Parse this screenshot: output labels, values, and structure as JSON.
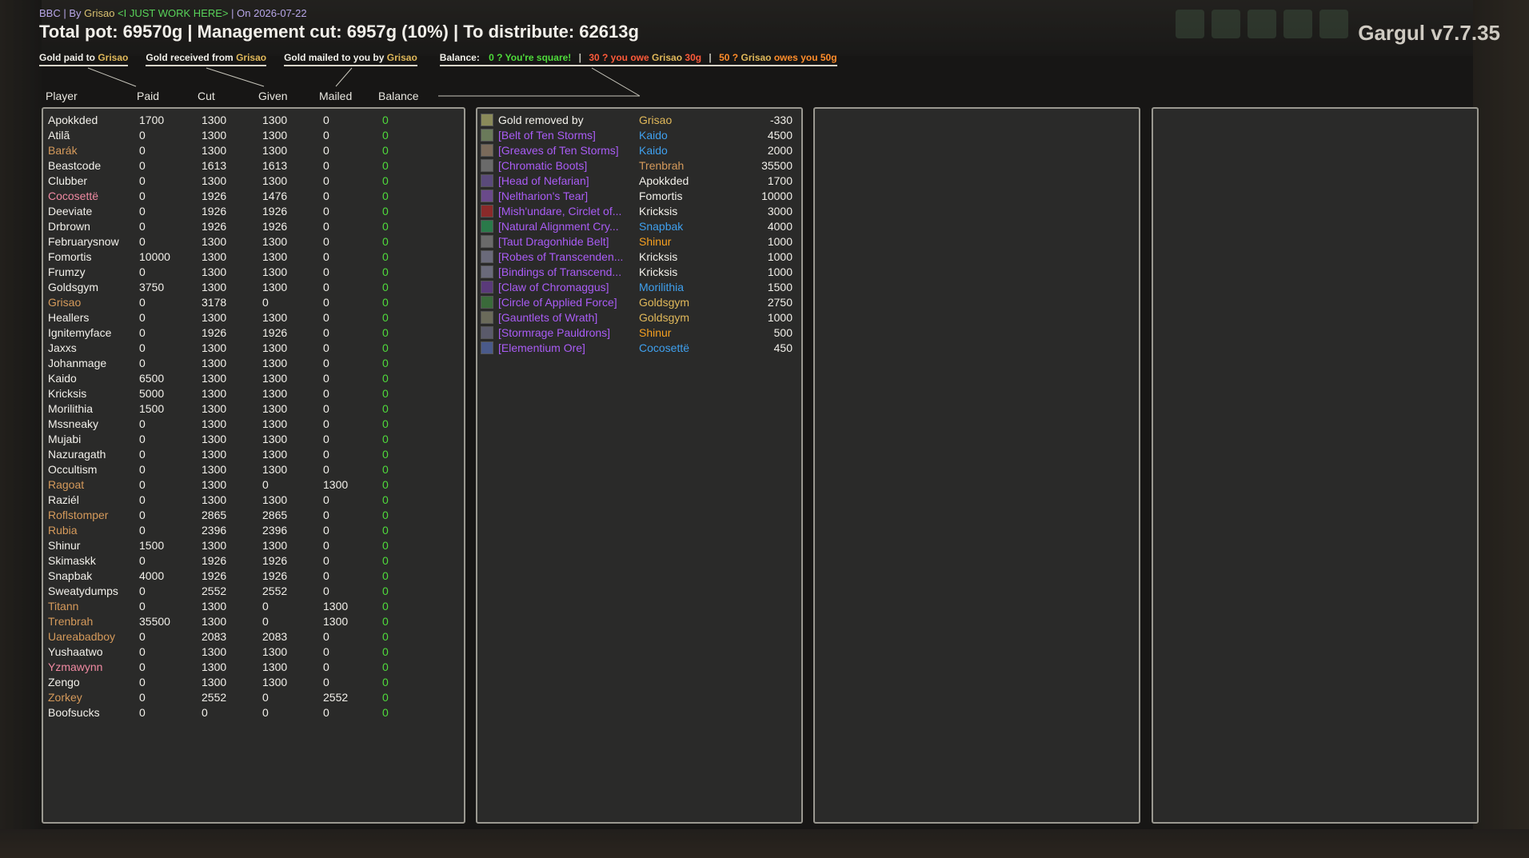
{
  "header": {
    "meta_prefix": "BBC | By",
    "meta_author": "Grisao",
    "meta_guild": "<I JUST WORK HERE>",
    "meta_date": "| On 2026-07-22",
    "title": "Total pot: 69570g | Management cut: 6957g (10%) | To distribute: 62613g",
    "brand": "Gargul v7.7.35"
  },
  "tabs": {
    "paid_label": "Gold paid to",
    "paid_name": "Grisao",
    "received_label": "Gold received from",
    "received_name": "Grisao",
    "mailed_label": "Gold mailed to you by",
    "mailed_name": "Grisao"
  },
  "balance": {
    "label": "Balance:",
    "square": "0 ? You're square!",
    "owe_prefix": "30 ? you owe",
    "owe_name": "Grisao",
    "owe_amount": "30g",
    "owed_prefix": "50 ?",
    "owed_name": "Grisao",
    "owed_suffix": "owes you 50g",
    "pipe": "|"
  },
  "columns": {
    "player": "Player",
    "paid": "Paid",
    "cut": "Cut",
    "given": "Given",
    "mailed": "Mailed",
    "balance": "Balance"
  },
  "players": [
    {
      "name": "Apokkded",
      "paid": "1700",
      "cut": "1300",
      "given": "1300",
      "mailed": "0",
      "balance": "0",
      "color": "white"
    },
    {
      "name": "Atilã",
      "paid": "0",
      "cut": "1300",
      "given": "1300",
      "mailed": "0",
      "balance": "0",
      "color": "white"
    },
    {
      "name": "Barák",
      "paid": "0",
      "cut": "1300",
      "given": "1300",
      "mailed": "0",
      "balance": "0",
      "color": "orange"
    },
    {
      "name": "Beastcode",
      "paid": "0",
      "cut": "1613",
      "given": "1613",
      "mailed": "0",
      "balance": "0",
      "color": "white"
    },
    {
      "name": "Clubber",
      "paid": "0",
      "cut": "1300",
      "given": "1300",
      "mailed": "0",
      "balance": "0",
      "color": "white"
    },
    {
      "name": "Cocosettë",
      "paid": "0",
      "cut": "1926",
      "given": "1476",
      "mailed": "0",
      "balance": "0",
      "color": "pink"
    },
    {
      "name": "Deeviate",
      "paid": "0",
      "cut": "1926",
      "given": "1926",
      "mailed": "0",
      "balance": "0",
      "color": "white"
    },
    {
      "name": "Drbrown",
      "paid": "0",
      "cut": "1926",
      "given": "1926",
      "mailed": "0",
      "balance": "0",
      "color": "white"
    },
    {
      "name": "Februarysnow",
      "paid": "0",
      "cut": "1300",
      "given": "1300",
      "mailed": "0",
      "balance": "0",
      "color": "white"
    },
    {
      "name": "Fomortis",
      "paid": "10000",
      "cut": "1300",
      "given": "1300",
      "mailed": "0",
      "balance": "0",
      "color": "white"
    },
    {
      "name": "Frumzy",
      "paid": "0",
      "cut": "1300",
      "given": "1300",
      "mailed": "0",
      "balance": "0",
      "color": "white"
    },
    {
      "name": "Goldsgym",
      "paid": "3750",
      "cut": "1300",
      "given": "1300",
      "mailed": "0",
      "balance": "0",
      "color": "white"
    },
    {
      "name": "Grisao",
      "paid": "0",
      "cut": "3178",
      "given": "0",
      "mailed": "0",
      "balance": "0",
      "color": "orange"
    },
    {
      "name": "Heallers",
      "paid": "0",
      "cut": "1300",
      "given": "1300",
      "mailed": "0",
      "balance": "0",
      "color": "white"
    },
    {
      "name": "Ignitemyface",
      "paid": "0",
      "cut": "1926",
      "given": "1926",
      "mailed": "0",
      "balance": "0",
      "color": "white"
    },
    {
      "name": "Jaxxs",
      "paid": "0",
      "cut": "1300",
      "given": "1300",
      "mailed": "0",
      "balance": "0",
      "color": "white"
    },
    {
      "name": "Johanmage",
      "paid": "0",
      "cut": "1300",
      "given": "1300",
      "mailed": "0",
      "balance": "0",
      "color": "white"
    },
    {
      "name": "Kaido",
      "paid": "6500",
      "cut": "1300",
      "given": "1300",
      "mailed": "0",
      "balance": "0",
      "color": "white"
    },
    {
      "name": "Kricksis",
      "paid": "5000",
      "cut": "1300",
      "given": "1300",
      "mailed": "0",
      "balance": "0",
      "color": "white"
    },
    {
      "name": "Morilithia",
      "paid": "1500",
      "cut": "1300",
      "given": "1300",
      "mailed": "0",
      "balance": "0",
      "color": "white"
    },
    {
      "name": "Mssneaky",
      "paid": "0",
      "cut": "1300",
      "given": "1300",
      "mailed": "0",
      "balance": "0",
      "color": "white"
    },
    {
      "name": "Mujabi",
      "paid": "0",
      "cut": "1300",
      "given": "1300",
      "mailed": "0",
      "balance": "0",
      "color": "white"
    },
    {
      "name": "Nazuragath",
      "paid": "0",
      "cut": "1300",
      "given": "1300",
      "mailed": "0",
      "balance": "0",
      "color": "white"
    },
    {
      "name": "Occultism",
      "paid": "0",
      "cut": "1300",
      "given": "1300",
      "mailed": "0",
      "balance": "0",
      "color": "white"
    },
    {
      "name": "Ragoat",
      "paid": "0",
      "cut": "1300",
      "given": "0",
      "mailed": "1300",
      "balance": "0",
      "color": "orange"
    },
    {
      "name": "Raziél",
      "paid": "0",
      "cut": "1300",
      "given": "1300",
      "mailed": "0",
      "balance": "0",
      "color": "white"
    },
    {
      "name": "Roflstomper",
      "paid": "0",
      "cut": "2865",
      "given": "2865",
      "mailed": "0",
      "balance": "0",
      "color": "orange"
    },
    {
      "name": "Rubia",
      "paid": "0",
      "cut": "2396",
      "given": "2396",
      "mailed": "0",
      "balance": "0",
      "color": "orange"
    },
    {
      "name": "Shinur",
      "paid": "1500",
      "cut": "1300",
      "given": "1300",
      "mailed": "0",
      "balance": "0",
      "color": "white"
    },
    {
      "name": "Skimaskk",
      "paid": "0",
      "cut": "1926",
      "given": "1926",
      "mailed": "0",
      "balance": "0",
      "color": "white"
    },
    {
      "name": "Snapbak",
      "paid": "4000",
      "cut": "1926",
      "given": "1926",
      "mailed": "0",
      "balance": "0",
      "color": "white"
    },
    {
      "name": "Sweatydumps",
      "paid": "0",
      "cut": "2552",
      "given": "2552",
      "mailed": "0",
      "balance": "0",
      "color": "white"
    },
    {
      "name": "Titann",
      "paid": "0",
      "cut": "1300",
      "given": "0",
      "mailed": "1300",
      "balance": "0",
      "color": "orange"
    },
    {
      "name": "Trenbrah",
      "paid": "35500",
      "cut": "1300",
      "given": "0",
      "mailed": "1300",
      "balance": "0",
      "color": "orange"
    },
    {
      "name": "Uareabadboy",
      "paid": "0",
      "cut": "2083",
      "given": "2083",
      "mailed": "0",
      "balance": "0",
      "color": "orange"
    },
    {
      "name": "Yushaatwo",
      "paid": "0",
      "cut": "1300",
      "given": "1300",
      "mailed": "0",
      "balance": "0",
      "color": "white"
    },
    {
      "name": "Yzmawynn",
      "paid": "0",
      "cut": "1300",
      "given": "1300",
      "mailed": "0",
      "balance": "0",
      "color": "pink"
    },
    {
      "name": "Zengo",
      "paid": "0",
      "cut": "1300",
      "given": "1300",
      "mailed": "0",
      "balance": "0",
      "color": "white"
    },
    {
      "name": "Zorkey",
      "paid": "0",
      "cut": "2552",
      "given": "0",
      "mailed": "2552",
      "balance": "0",
      "color": "orange"
    },
    {
      "name": "Boofsucks",
      "paid": "0",
      "cut": "0",
      "given": "0",
      "mailed": "0",
      "balance": "0",
      "color": "white"
    }
  ],
  "ledger": [
    {
      "item": "Gold removed by",
      "item_color": "white",
      "player": "Grisao",
      "player_color": "gold",
      "amount": "-330",
      "icon": "coin-icon",
      "icon_color": "#8a8a5a"
    },
    {
      "item": "[Belt of Ten Storms]",
      "item_color": "purple",
      "player": "Kaido",
      "player_color": "blue",
      "amount": "4500",
      "icon": "belt-icon",
      "icon_color": "#6a7a5a"
    },
    {
      "item": "[Greaves of Ten Storms]",
      "item_color": "purple",
      "player": "Kaido",
      "player_color": "blue",
      "amount": "2000",
      "icon": "greaves-icon",
      "icon_color": "#7a6a5a"
    },
    {
      "item": "[Chromatic Boots]",
      "item_color": "purple",
      "player": "Trenbrah",
      "player_color": "orange",
      "amount": "35500",
      "icon": "boots-icon",
      "icon_color": "#6a6a6a"
    },
    {
      "item": "[Head of Nefarian]",
      "item_color": "purple",
      "player": "Apokkded",
      "player_color": "white",
      "amount": "1700",
      "icon": "head-icon",
      "icon_color": "#5a4a7a"
    },
    {
      "item": "[Neltharion's Tear]",
      "item_color": "purple",
      "player": "Fomortis",
      "player_color": "white",
      "amount": "10000",
      "icon": "tear-icon",
      "icon_color": "#6a4a8a"
    },
    {
      "item": "[Mish'undare, Circlet of...",
      "item_color": "purple",
      "player": "Kricksis",
      "player_color": "white",
      "amount": "3000",
      "icon": "circlet-icon",
      "icon_color": "#8a2a2a"
    },
    {
      "item": "[Natural Alignment Cry...",
      "item_color": "purple",
      "player": "Snapbak",
      "player_color": "blue",
      "amount": "4000",
      "icon": "crystal-icon",
      "icon_color": "#2a7a4a"
    },
    {
      "item": "[Taut Dragonhide Belt]",
      "item_color": "purple",
      "player": "Shinur",
      "player_color": "amber",
      "amount": "1000",
      "icon": "belt-icon",
      "icon_color": "#6a6a6a"
    },
    {
      "item": "[Robes of Transcenden...",
      "item_color": "purple",
      "player": "Kricksis",
      "player_color": "white",
      "amount": "1000",
      "icon": "robe-icon",
      "icon_color": "#6a6a7a"
    },
    {
      "item": "[Bindings of Transcend...",
      "item_color": "purple",
      "player": "Kricksis",
      "player_color": "white",
      "amount": "1000",
      "icon": "bracer-icon",
      "icon_color": "#6a6a7a"
    },
    {
      "item": "[Claw of Chromaggus]",
      "item_color": "purple",
      "player": "Morilithia",
      "player_color": "blue",
      "amount": "1500",
      "icon": "claw-icon",
      "icon_color": "#5a3a7a"
    },
    {
      "item": "[Circle of Applied Force]",
      "item_color": "purple",
      "player": "Goldsgym",
      "player_color": "gold",
      "amount": "2750",
      "icon": "ring-icon",
      "icon_color": "#3a6a3a"
    },
    {
      "item": "[Gauntlets of Wrath]",
      "item_color": "purple",
      "player": "Goldsgym",
      "player_color": "gold",
      "amount": "1000",
      "icon": "gauntlets-icon",
      "icon_color": "#6a6a5a"
    },
    {
      "item": "[Stormrage Pauldrons]",
      "item_color": "purple",
      "player": "Shinur",
      "player_color": "amber",
      "amount": "500",
      "icon": "pauldrons-icon",
      "icon_color": "#5a5a6a"
    },
    {
      "item": "[Elementium Ore]",
      "item_color": "purple",
      "player": "Cocosettë",
      "player_color": "blue",
      "amount": "450",
      "icon": "ore-icon",
      "icon_color": "#4a5a8a"
    }
  ]
}
